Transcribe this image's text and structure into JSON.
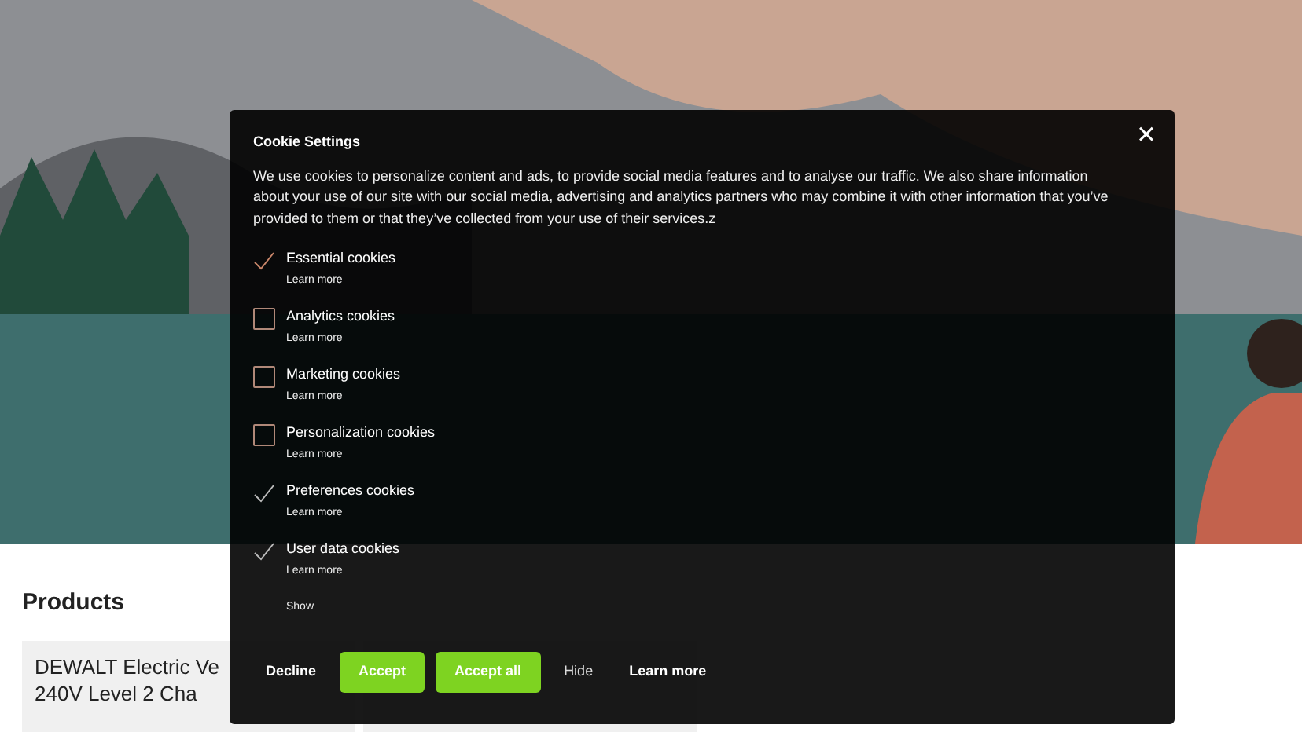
{
  "products": {
    "heading": "Products",
    "cards": [
      {
        "title_lines": [
          "DEWALT Electric Ve",
          "240V Level 2 Cha"
        ]
      }
    ]
  },
  "cookie_dialog": {
    "title": "Cookie Settings",
    "close": "×",
    "description": "We use cookies to personalize content and ads, to provide social media features and to analyse our traffic. We also share information about your use of our site with our social media, advertising and analytics partners who may combine it with other information that you’ve provided to them or that they’ve collected from your use of their services.z",
    "categories": [
      {
        "label": "Essential cookies",
        "link": "Learn more",
        "checked": true,
        "disabled": true
      },
      {
        "label": "Analytics cookies",
        "link": "Learn more",
        "checked": false,
        "disabled": false
      },
      {
        "label": "Marketing cookies",
        "link": "Learn more",
        "checked": false,
        "disabled": false
      },
      {
        "label": "Personalization cookies",
        "link": "Learn more",
        "checked": false,
        "disabled": false
      },
      {
        "label": "Preferences cookies",
        "link": "Learn more",
        "checked": true,
        "disabled": false
      },
      {
        "label": "User data cookies",
        "link": "Learn more",
        "checked": true,
        "disabled": false
      }
    ],
    "show": "Show",
    "buttons": [
      {
        "label": "Decline",
        "kind": "bold"
      },
      {
        "label": "Accept",
        "kind": "primary"
      },
      {
        "label": "Accept all",
        "kind": "primary"
      },
      {
        "label": "Hide",
        "kind": "plain"
      },
      {
        "label": "Learn more",
        "kind": "bold"
      }
    ]
  }
}
